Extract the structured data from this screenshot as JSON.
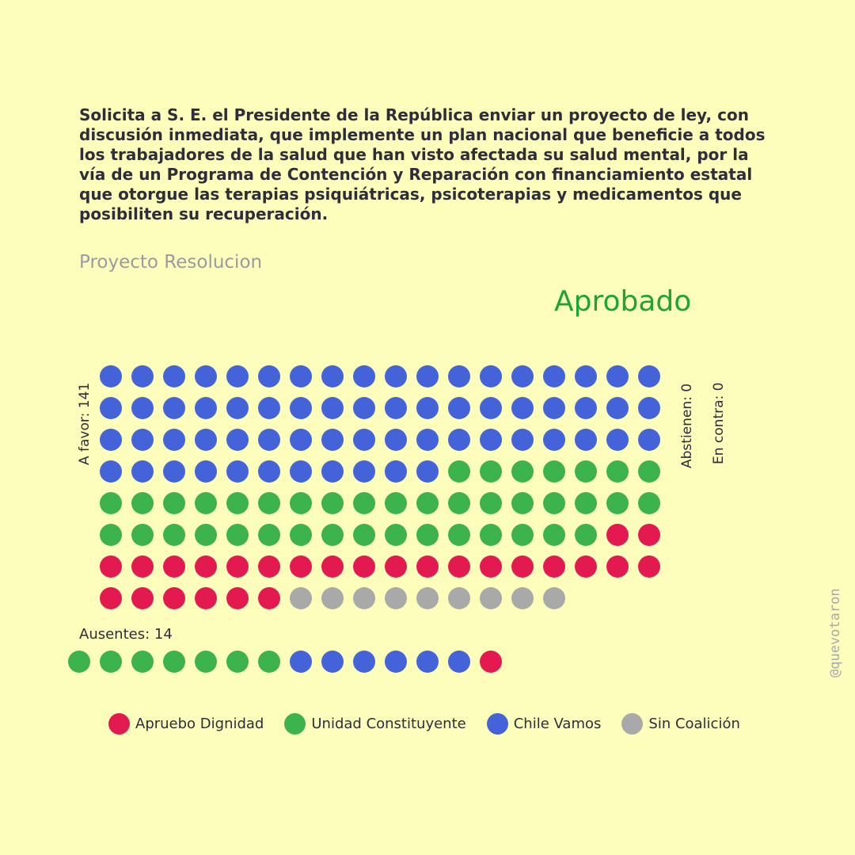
{
  "title": "Solicita a S. E. el Presidente de la República enviar un proyecto de ley, con discusión inmediata, que implemente un plan nacional que beneficie a todos los trabajadores de la salud que han visto afectada su salud mental, por la vía de un Programa de Contención y Reparación con financiamiento estatal que otorgue las terapias psiquiátricas, psicoterapias y medicamentos que posibiliten su recuperación.",
  "subtitle": "Proyecto Resolucion",
  "result": "Aprobado",
  "labels": {
    "a_favor": "A favor: 141",
    "abstienen": "Abstienen: 0",
    "en_contra": "En contra: 0",
    "ausentes": "Ausentes: 14"
  },
  "credit": "@quevotaron",
  "colors": {
    "background": "#fdfdbc",
    "apruebo_dignidad": "#e31a4f",
    "unidad_constituyente": "#3db34e",
    "chile_vamos": "#4463d8",
    "sin_coalicion": "#a9a9a9",
    "result": "#1fa335"
  },
  "legend": [
    {
      "label": "Apruebo Dignidad",
      "color": "#e31a4f"
    },
    {
      "label": "Unidad Constituyente",
      "color": "#3db34e"
    },
    {
      "label": "Chile Vamos",
      "color": "#4463d8"
    },
    {
      "label": "Sin Coalición",
      "color": "#a9a9a9"
    }
  ],
  "chart_data": {
    "type": "waffle",
    "groups": [
      {
        "name": "A favor",
        "total": 141,
        "breakdown": [
          {
            "coalition": "Chile Vamos",
            "count": 65
          },
          {
            "coalition": "Unidad Constituyente",
            "count": 41
          },
          {
            "coalition": "Apruebo Dignidad",
            "count": 26
          },
          {
            "coalition": "Sin Coalición",
            "count": 9
          }
        ]
      },
      {
        "name": "Abstienen",
        "total": 0,
        "breakdown": []
      },
      {
        "name": "En contra",
        "total": 0,
        "breakdown": []
      },
      {
        "name": "Ausentes",
        "total": 14,
        "breakdown": [
          {
            "coalition": "Unidad Constituyente",
            "count": 7
          },
          {
            "coalition": "Chile Vamos",
            "count": 6
          },
          {
            "coalition": "Apruebo Dignidad",
            "count": 1
          }
        ]
      }
    ]
  }
}
